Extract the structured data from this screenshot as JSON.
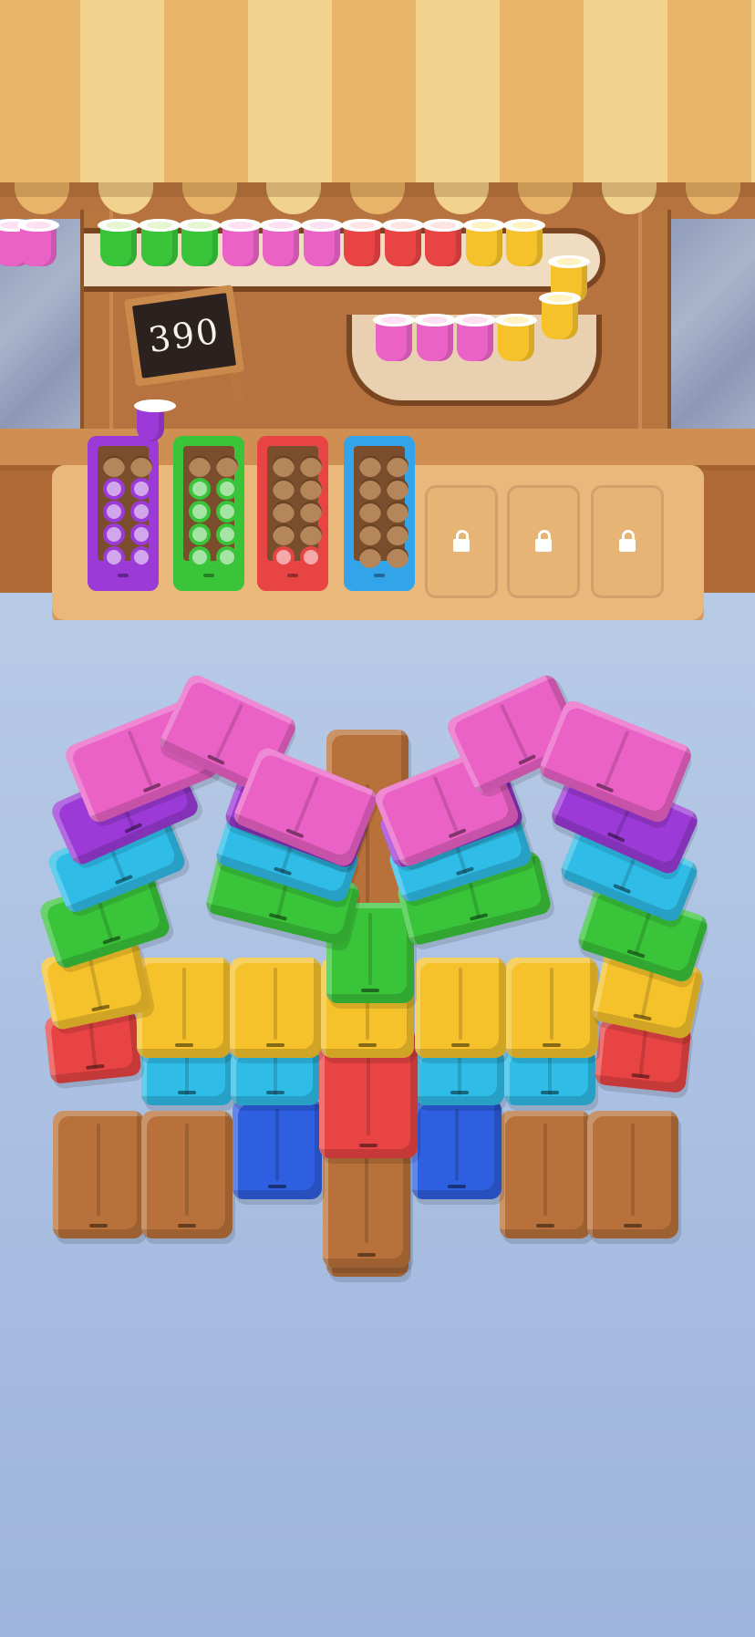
{
  "score": {
    "value": "390"
  },
  "colors": {
    "purple": "#9b3ad6",
    "green": "#3ac43a",
    "red": "#e84444",
    "blue": "#34a4ea",
    "pink": "#ea62c6",
    "yellow": "#f5c22c",
    "cyan": "#2fbde8",
    "royal": "#2e5fe0",
    "brown": "#b8713a"
  },
  "awning": {
    "stripe_a": "#e7b469",
    "stripe_b": "#f2d38e"
  },
  "conveyor": {
    "top_row": [
      "green",
      "green",
      "green",
      "pink",
      "pink",
      "pink",
      "red",
      "red",
      "red",
      "yellow",
      "yellow"
    ],
    "curve": [
      "yellow",
      "yellow"
    ],
    "bottom_row": [
      "pink",
      "pink",
      "pink",
      "yellow"
    ]
  },
  "boxes": [
    {
      "name": "purple-box",
      "color": "purple",
      "filled": 8,
      "capacity": 10
    },
    {
      "name": "green-box",
      "color": "green",
      "filled": 8,
      "capacity": 10
    },
    {
      "name": "red-box",
      "color": "red",
      "filled": 2,
      "capacity": 10
    },
    {
      "name": "blue-box",
      "color": "blue",
      "filled": 0,
      "capacity": 10
    }
  ],
  "held_cup": {
    "color": "purple"
  },
  "locked_slots": [
    {
      "name": "locked-slot-1"
    },
    {
      "name": "locked-slot-2"
    },
    {
      "name": "locked-slot-3"
    }
  ],
  "icons": {
    "lock": "lock-icon"
  }
}
